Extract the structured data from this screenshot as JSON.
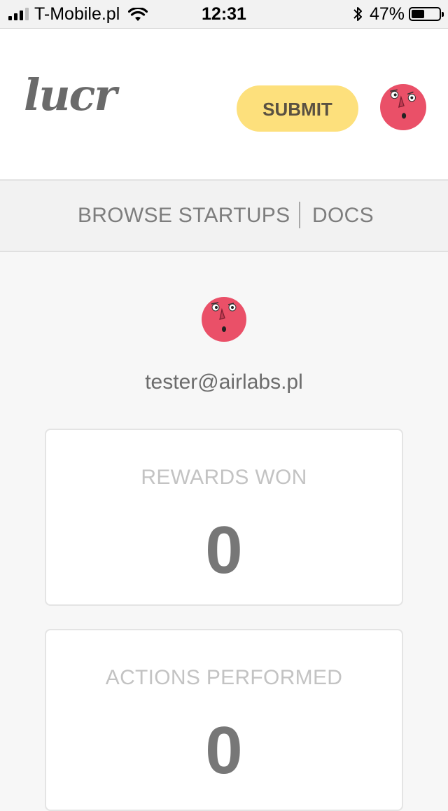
{
  "status_bar": {
    "carrier": "T-Mobile.pl",
    "time": "12:31",
    "battery_percent": "47%",
    "battery_level": 0.47,
    "icons": [
      "signal-icon",
      "wifi-icon",
      "bluetooth-icon",
      "battery-icon"
    ]
  },
  "header": {
    "logo": "lucr",
    "submit_label": "SUBMIT",
    "accent_color": "#fde07c"
  },
  "nav": {
    "browse_label": "BROWSE STARTUPS",
    "docs_label": "DOCS"
  },
  "profile": {
    "email": "tester@airlabs.pl",
    "avatar_color": "#ea5068"
  },
  "stats": [
    {
      "label": "REWARDS WON",
      "value": "0"
    },
    {
      "label": "ACTIONS PERFORMED",
      "value": "0"
    }
  ]
}
